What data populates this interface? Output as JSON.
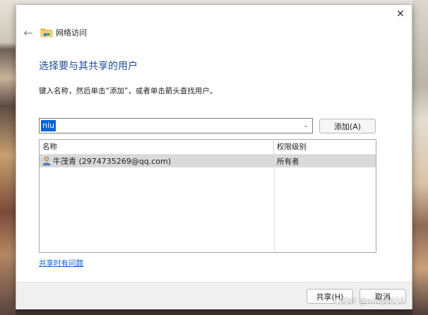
{
  "window": {
    "title": "网络访问",
    "close_glyph": "✕",
    "back_glyph": "←"
  },
  "content": {
    "heading": "选择要与其共享的用户",
    "instruction": "键入名称，然后单击“添加”，或者单击箭头查找用户。"
  },
  "user_input": {
    "value": "niu",
    "dropdown_glyph": "⌄"
  },
  "buttons": {
    "add": "添加(A)",
    "share": "共享(H)",
    "cancel": "取消"
  },
  "list": {
    "columns": [
      "名称",
      "权限级别"
    ],
    "rows": [
      {
        "name": "牛茂青 (2974735269@qq.com)",
        "permission": "所有者"
      }
    ]
  },
  "help_link": "共享时有问题",
  "watermark": "CSDN @nmq0816",
  "colors": {
    "heading": "#1f4e95",
    "link": "#0b63c9",
    "selection": "#0a64d8",
    "row_selected": "#d9d9d9"
  },
  "icons": {
    "back": "back-arrow-icon",
    "window": "network-folder-icon",
    "user": "user-icon",
    "dropdown": "chevron-down-icon",
    "close": "close-icon"
  }
}
